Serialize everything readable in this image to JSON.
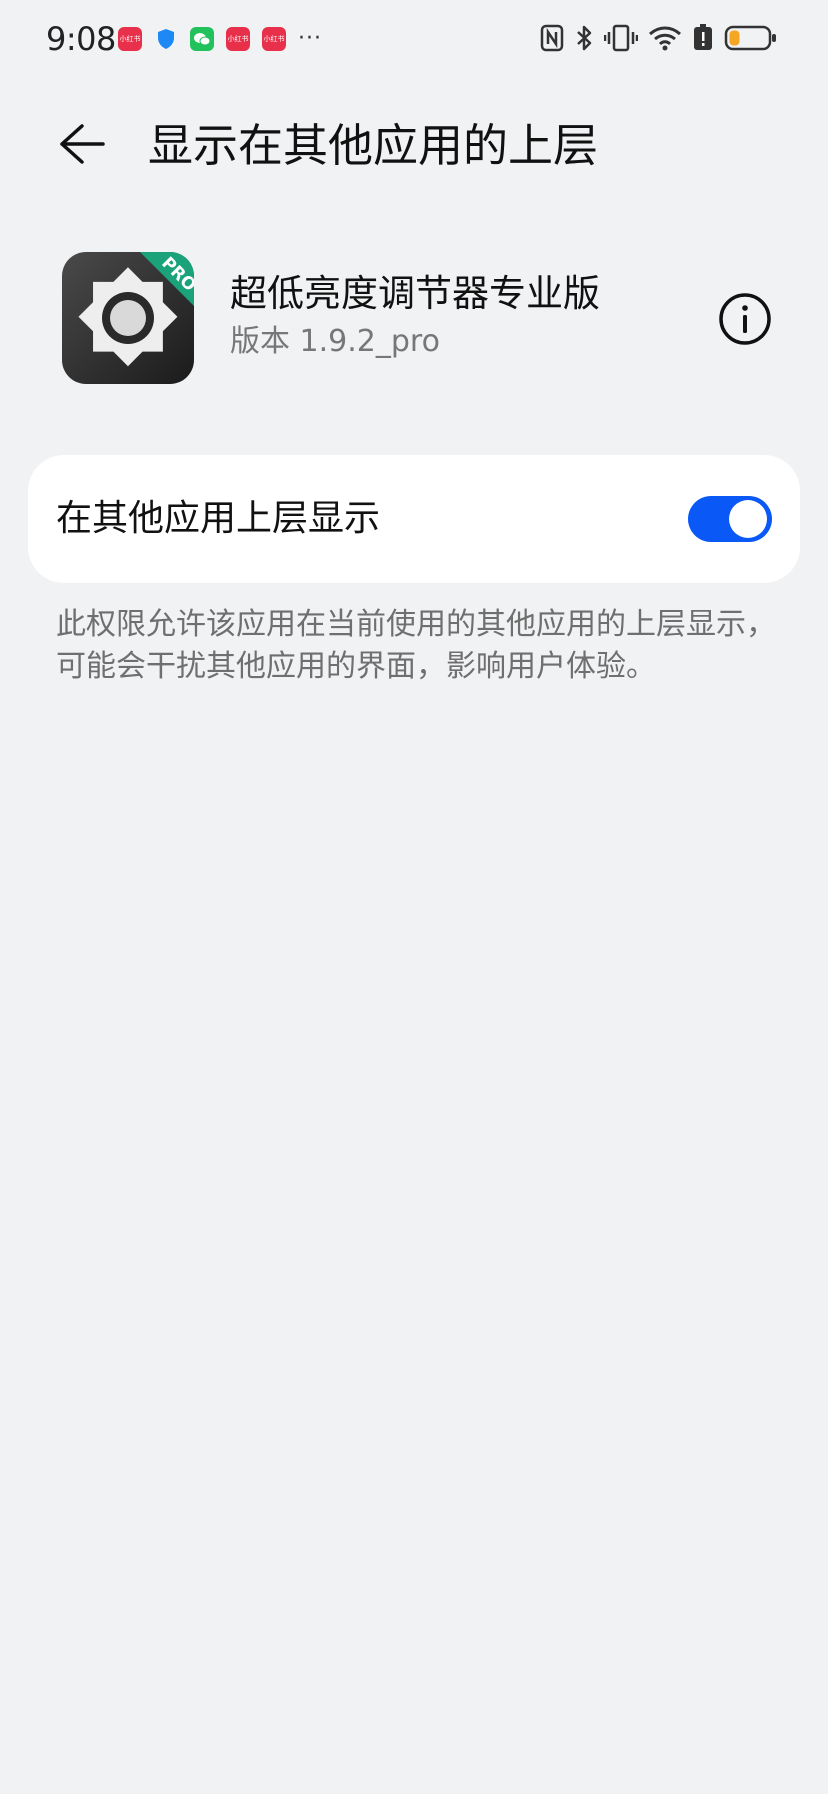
{
  "status_bar": {
    "time": "9:08",
    "notification_badges": [
      "小红书",
      "小红书",
      "小红书"
    ],
    "more_indicator": "···",
    "icons": [
      "nfc-icon",
      "bluetooth-icon",
      "vibrate-icon",
      "wifi-icon",
      "battery-saver-icon",
      "battery-icon"
    ],
    "battery_color": "#f5a623"
  },
  "header": {
    "title": "显示在其他应用的上层"
  },
  "app": {
    "name": "超低亮度调节器专业版",
    "version": "版本 1.9.2_pro",
    "icon_badge": "PRO",
    "badge_color": "#1aa37a"
  },
  "setting": {
    "label": "在其他应用上层显示",
    "enabled": true,
    "accent_color": "#0a59f7"
  },
  "description": "此权限允许该应用在当前使用的其他应用的上层显示，可能会干扰其他应用的界面，影响用户体验。"
}
